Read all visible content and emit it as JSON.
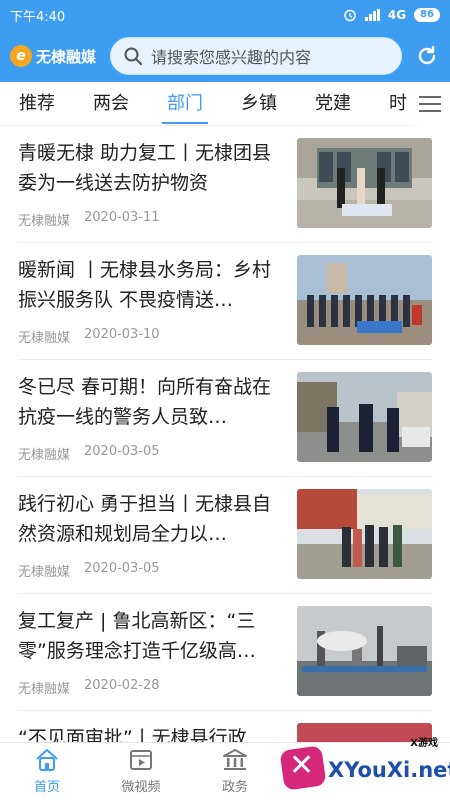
{
  "status": {
    "time": "下午4:40",
    "network": "4G",
    "battery": "86"
  },
  "header": {
    "app_name": "无棣融媒",
    "search_placeholder": "请搜索您感兴趣的内容"
  },
  "tabs": [
    {
      "label": "推荐"
    },
    {
      "label": "两会"
    },
    {
      "label": "部门",
      "active": true
    },
    {
      "label": "乡镇"
    },
    {
      "label": "党建"
    },
    {
      "label": "时"
    }
  ],
  "news": [
    {
      "title": "青暖无棣 助力复工丨无棣团县委为一线送去防护物资",
      "source": "无棣融媒",
      "date": "2020-03-11"
    },
    {
      "title": "暖新闻 丨无棣县水务局：乡村振兴服务队 不畏疫情送…",
      "source": "无棣融媒",
      "date": "2020-03-10"
    },
    {
      "title": "冬已尽 春可期！向所有奋战在抗疫一线的警务人员致…",
      "source": "无棣融媒",
      "date": "2020-03-05"
    },
    {
      "title": "践行初心 勇于担当丨无棣县自然资源和规划局全力以…",
      "source": "无棣融媒",
      "date": "2020-03-05"
    },
    {
      "title": "复工复产 | 鲁北高新区：“三零”服务理念打造千亿级高…",
      "source": "无棣融媒",
      "date": "2020-02-28"
    },
    {
      "title": "“不见面审批”丨无棣县行政",
      "source": "",
      "date": ""
    }
  ],
  "bottom_nav": [
    {
      "label": "首页",
      "icon": "home-icon",
      "active": true
    },
    {
      "label": "微视频",
      "icon": "video-icon"
    },
    {
      "label": "政务",
      "icon": "government-icon"
    }
  ],
  "watermark": {
    "site": "XYouXi.net",
    "small": "X游戏"
  },
  "colors": {
    "accent": "#3d9df0",
    "text": "#222222",
    "meta": "#999999"
  }
}
